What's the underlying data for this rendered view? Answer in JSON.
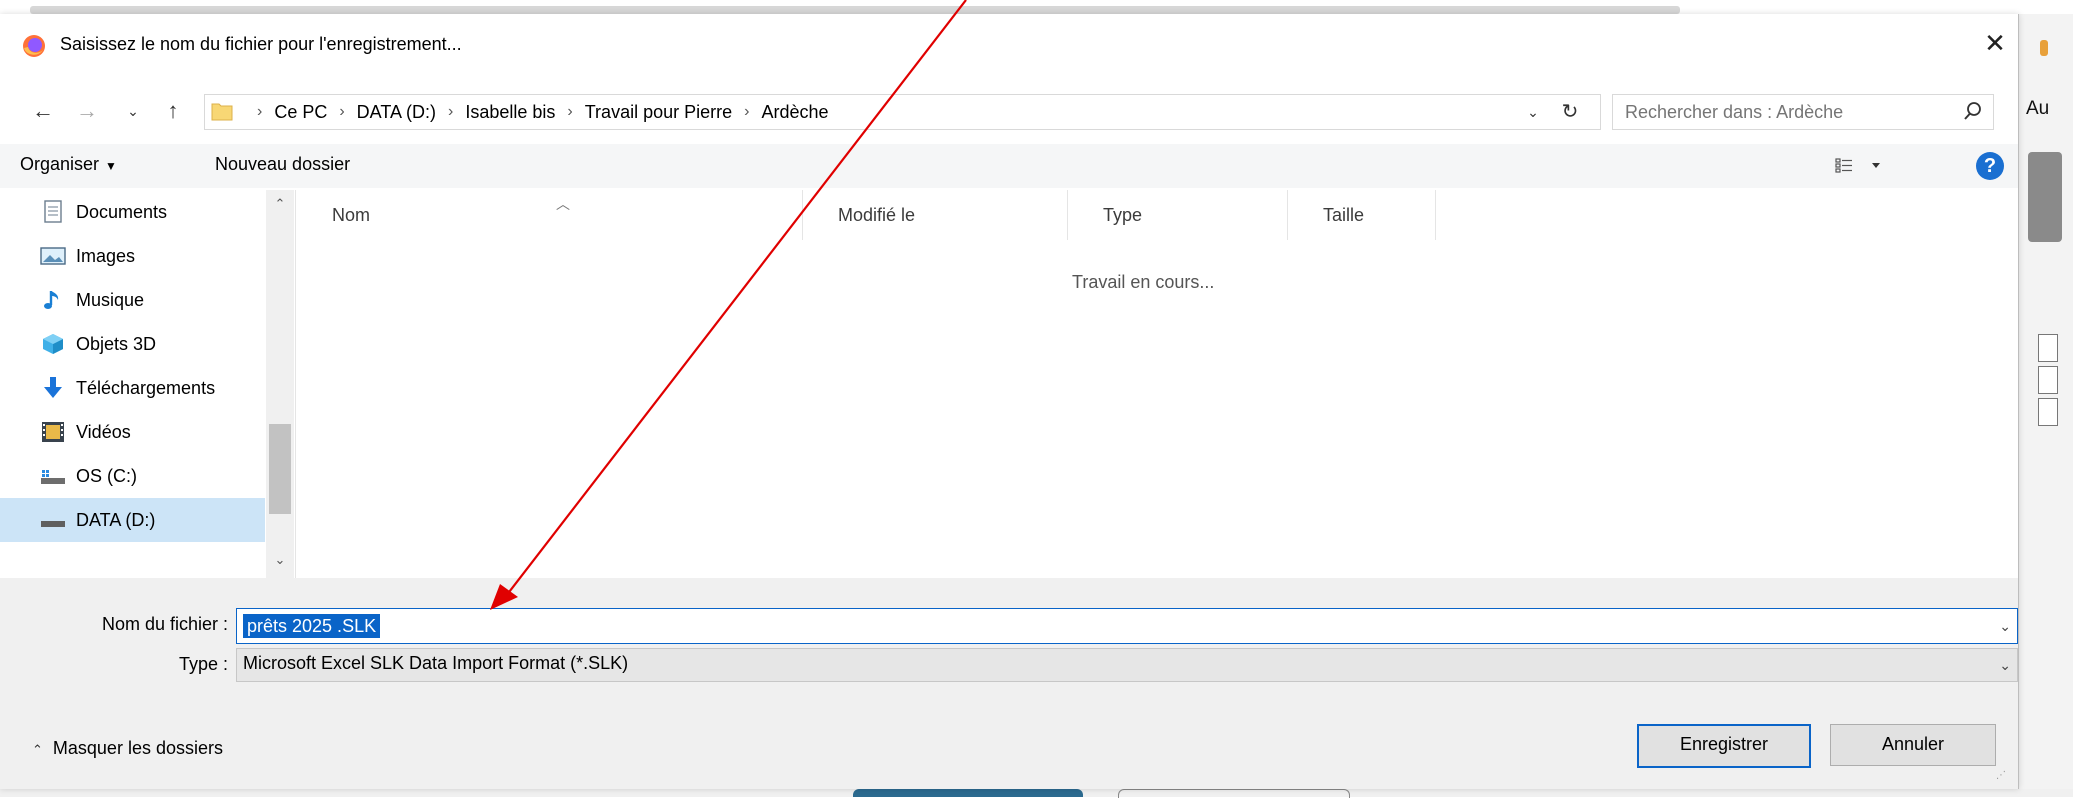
{
  "dialog": {
    "title": "Saisissez le nom du fichier pour l'enregistrement...",
    "close_symbol": "✕"
  },
  "address_bar": {
    "crumbs": [
      "Ce PC",
      "DATA (D:)",
      "Isabelle bis",
      "Travail pour Pierre",
      "Ardèche"
    ],
    "search_placeholder": "Rechercher dans : Ardèche"
  },
  "toolbar": {
    "organiser_label": "Organiser",
    "new_folder_label": "Nouveau dossier",
    "help_label": "?"
  },
  "nav_pane": {
    "items": [
      {
        "label": "Documents",
        "icon": "documents-icon"
      },
      {
        "label": "Images",
        "icon": "images-icon"
      },
      {
        "label": "Musique",
        "icon": "music-icon"
      },
      {
        "label": "Objets 3D",
        "icon": "objects3d-icon"
      },
      {
        "label": "Téléchargements",
        "icon": "downloads-icon"
      },
      {
        "label": "Vidéos",
        "icon": "videos-icon"
      },
      {
        "label": "OS (C:)",
        "icon": "drive-c-icon"
      },
      {
        "label": "DATA (D:)",
        "icon": "drive-d-icon",
        "selected": true
      }
    ]
  },
  "file_list": {
    "columns": [
      "Nom",
      "Modifié le",
      "Type",
      "Taille"
    ],
    "status_text": "Travail en cours..."
  },
  "form": {
    "filename_label": "Nom du fichier :",
    "filename_value": "prêts 2025 .SLK",
    "type_label": "Type :",
    "type_value": "Microsoft Excel SLK Data Import Format (*.SLK)",
    "hide_folders_label": "Masquer les dossiers",
    "save_label": "Enregistrer",
    "cancel_label": "Annuler"
  },
  "background": {
    "right_fragment_text": "Au"
  },
  "colors": {
    "accent": "#0a64c8",
    "selection_bg": "#cce4f7",
    "annotation_arrow": "#e00000",
    "help_button": "#1a6fd1"
  }
}
